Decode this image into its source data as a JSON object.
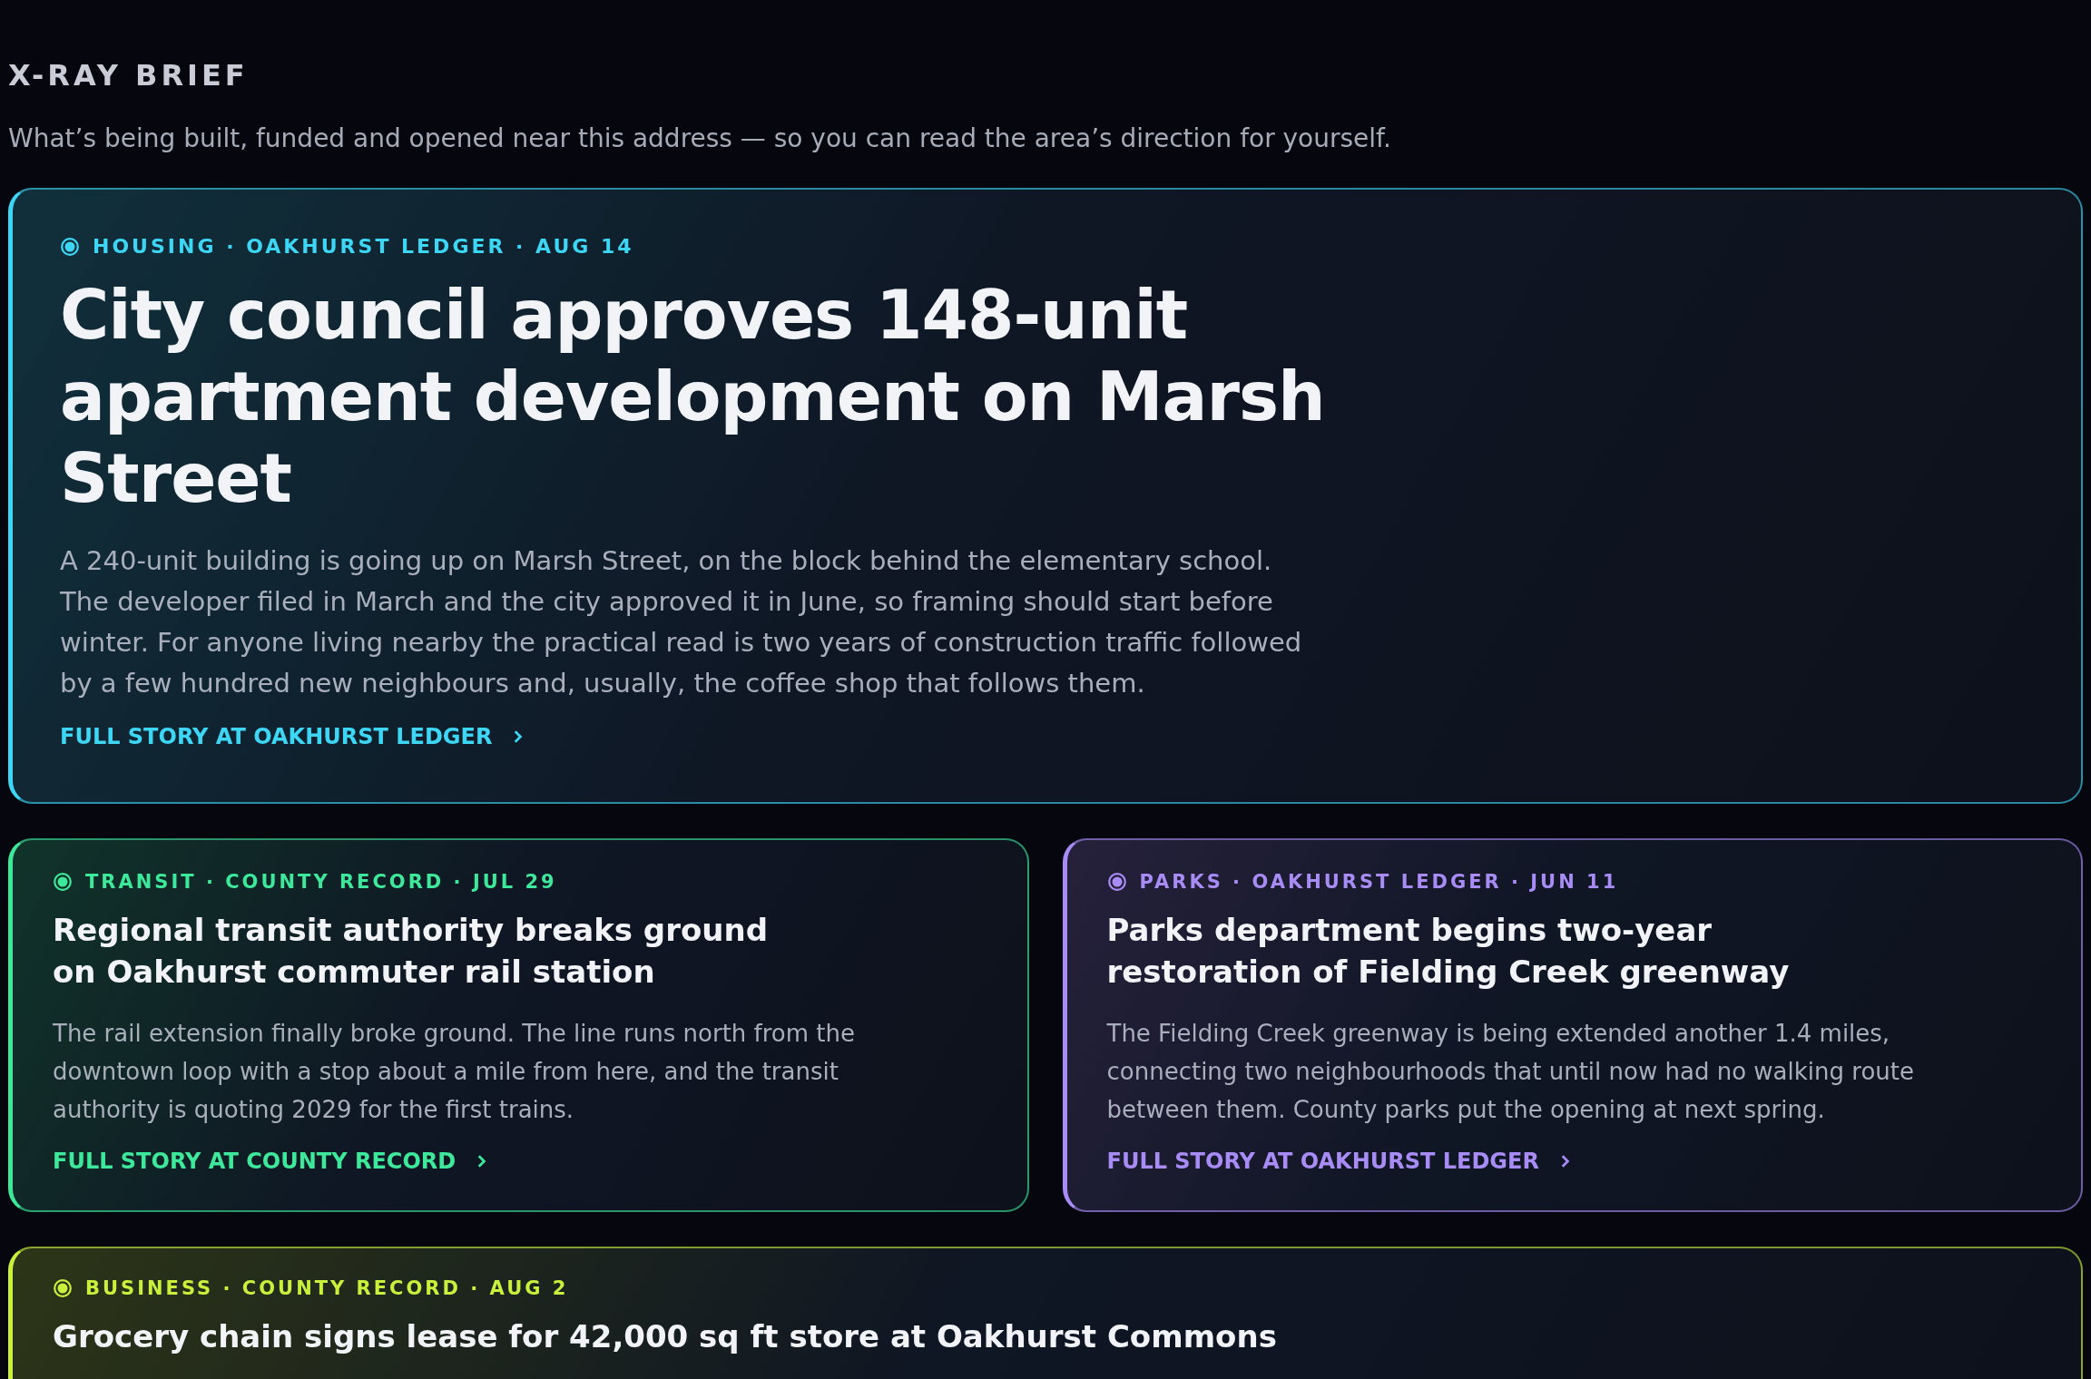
{
  "brief": {
    "title": "X-RAY BRIEF",
    "subtitle": "What’s being built, funded and opened near this address — so you can read the area’s direction for yourself."
  },
  "stories": [
    {
      "kind": "feature",
      "color": "#3dd6f5",
      "tag": "HOUSING · OAKHURST LEDGER · AUG 14",
      "headline": "City council approves 148-unit apartment development on Marsh Street",
      "body": "A 240-unit building is going up on Marsh Street, on the block behind the elementary school. The developer filed in March and the city approved it in June, so framing should start before winter. For anyone living nearby the practical read is two years of construction traffic followed by a few hundred new neighbours and, usually, the coffee shop that follows them.",
      "link": "FULL STORY AT OAKHURST LEDGER"
    },
    {
      "kind": "half",
      "color": "#3ee89a",
      "tag": "TRANSIT · COUNTY RECORD · JUL 29",
      "headline": "Regional transit authority breaks ground on Oakhurst commuter rail station",
      "body": "The rail extension finally broke ground. The line runs north from the downtown loop with a stop about a mile from here, and the transit authority is quoting 2029 for the first trains.",
      "link": "FULL STORY AT COUNTY RECORD"
    },
    {
      "kind": "half",
      "color": "#a98bf5",
      "tag": "PARKS · OAKHURST LEDGER · JUN 11",
      "headline": "Parks department begins two-year restoration of Fielding Creek greenway",
      "body": "The Fielding Creek greenway is being extended another 1.4 miles, connecting two neighbourhoods that until now had no walking route between them. County parks put the opening at next spring.",
      "link": "FULL STORY AT OAKHURST LEDGER"
    },
    {
      "kind": "wide",
      "color": "#c8f03c",
      "tag": "BUSINESS · COUNTY RECORD · AUG 2",
      "headline": "Grocery chain signs lease for 42,000 sq ft store at Oakhurst Commons"
    }
  ]
}
